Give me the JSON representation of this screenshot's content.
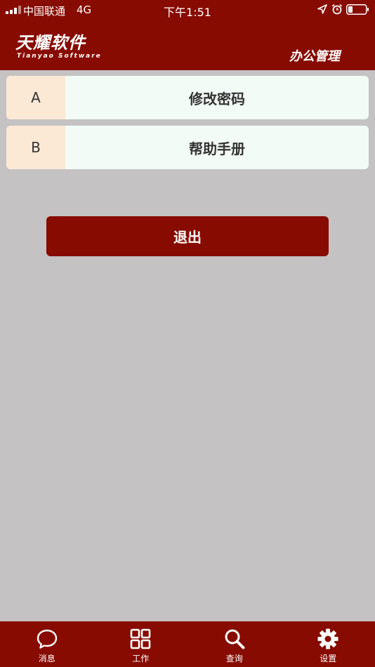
{
  "status_bar": {
    "carrier": "中国联通",
    "network": "4G",
    "time": "下午1:51"
  },
  "header": {
    "logo_cn": "天耀软件",
    "logo_en": "Tianyao Software",
    "title": "办公管理"
  },
  "menu": {
    "items": [
      {
        "key": "A",
        "label": "修改密码"
      },
      {
        "key": "B",
        "label": "帮助手册"
      }
    ]
  },
  "logout": {
    "label": "退出"
  },
  "tabs": [
    {
      "label": "消息",
      "icon": "chat-bubble-icon"
    },
    {
      "label": "工作",
      "icon": "grid-icon"
    },
    {
      "label": "查询",
      "icon": "search-icon"
    },
    {
      "label": "设置",
      "icon": "gear-icon"
    }
  ],
  "colors": {
    "brand": "#870b00",
    "background": "#c4c2c3",
    "menu_key_bg": "#fbe9d5",
    "menu_bg": "#f2fbf6"
  }
}
